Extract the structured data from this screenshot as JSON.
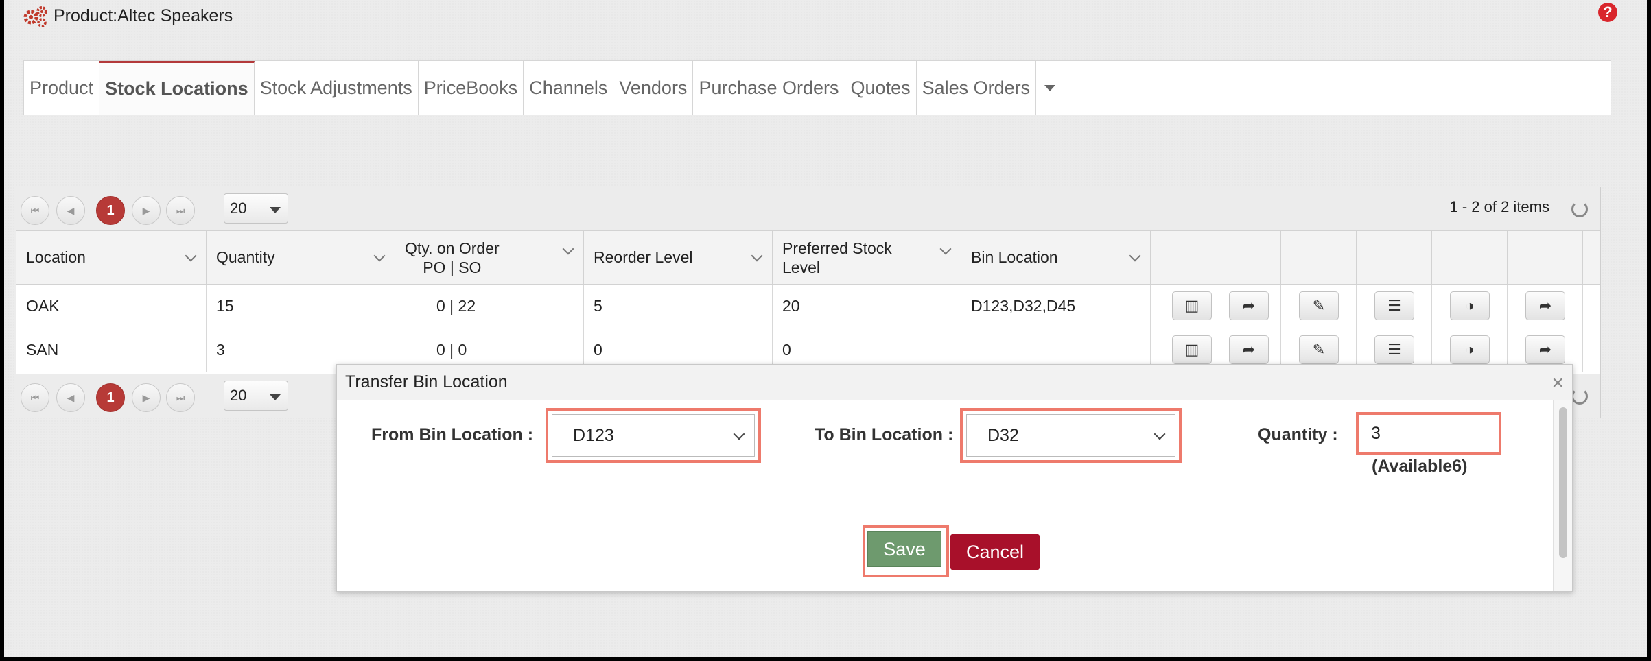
{
  "header": {
    "title": "Product:Altec Speakers"
  },
  "tabs": [
    {
      "label": "Product",
      "active": false
    },
    {
      "label": "Stock Locations",
      "active": true
    },
    {
      "label": "Stock Adjustments",
      "active": false
    },
    {
      "label": "PriceBooks",
      "active": false
    },
    {
      "label": "Channels",
      "active": false
    },
    {
      "label": "Vendors",
      "active": false
    },
    {
      "label": "Purchase Orders",
      "active": false
    },
    {
      "label": "Quotes",
      "active": false
    },
    {
      "label": "Sales Orders",
      "active": false
    }
  ],
  "pager": {
    "page": "1",
    "page_size": "20",
    "info": "1 - 2 of 2 items"
  },
  "grid": {
    "columns": [
      "Location",
      "Quantity",
      "Qty. on Order\nPO | SO",
      "Reorder Level",
      "Preferred Stock Level",
      "Bin Location"
    ],
    "rows": [
      {
        "location": "OAK",
        "quantity": "15",
        "on_order": "0 | 22",
        "reorder": "5",
        "preferred": "20",
        "bin": "D123,D32,D45"
      },
      {
        "location": "SAN",
        "quantity": "3",
        "on_order": "0 | 0",
        "reorder": "0",
        "preferred": "0",
        "bin": ""
      }
    ]
  },
  "modal": {
    "title": "Transfer Bin Location",
    "from_label": "From Bin Location :",
    "from_value": "D123",
    "to_label": "To Bin Location :",
    "to_value": "D32",
    "qty_label": "Quantity :",
    "qty_value": "3",
    "available": "(Available6)",
    "save": "Save",
    "cancel": "Cancel",
    "close": "×"
  },
  "colors": {
    "accent": "#b73a37",
    "save": "#6e9a6e",
    "cancel": "#a8102a",
    "highlight": "#ee7a6c"
  }
}
